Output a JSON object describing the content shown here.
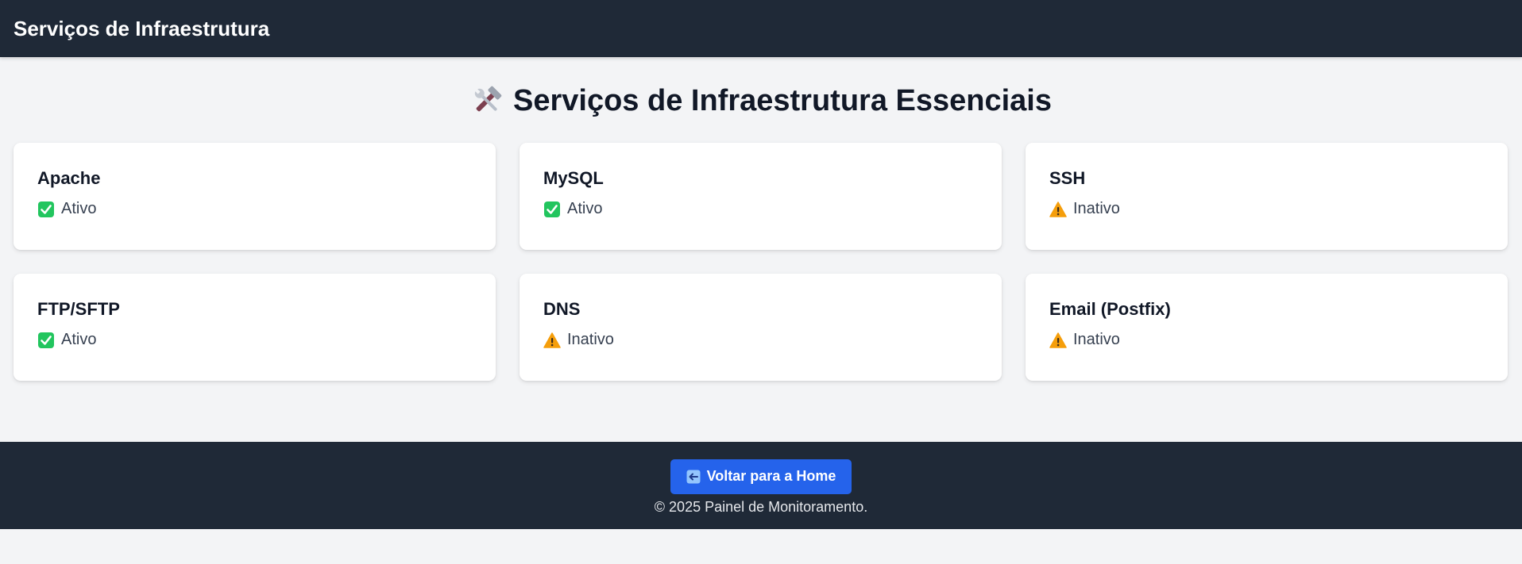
{
  "header": {
    "title": "Serviços de Infraestrutura"
  },
  "main": {
    "heading_icon": "hammer-and-wrench-icon",
    "heading": "Serviços de Infraestrutura Essenciais",
    "services": [
      {
        "name": "Apache",
        "status": "Ativo",
        "status_icon": "check-mark-icon"
      },
      {
        "name": "MySQL",
        "status": "Ativo",
        "status_icon": "check-mark-icon"
      },
      {
        "name": "SSH",
        "status": "Inativo",
        "status_icon": "warning-icon"
      },
      {
        "name": "FTP/SFTP",
        "status": "Ativo",
        "status_icon": "check-mark-icon"
      },
      {
        "name": "DNS",
        "status": "Inativo",
        "status_icon": "warning-icon"
      },
      {
        "name": "Email (Postfix)",
        "status": "Inativo",
        "status_icon": "warning-icon"
      }
    ]
  },
  "footer": {
    "home_button_label": "Voltar para a Home",
    "home_button_icon": "left-arrow-icon",
    "copyright": "© 2025 Painel de Monitoramento."
  },
  "colors": {
    "header_bg": "#1f2937",
    "page_bg": "#f3f4f6",
    "button_bg": "#2563eb",
    "active_green": "#22c55e",
    "warning_orange": "#f59e0b"
  }
}
